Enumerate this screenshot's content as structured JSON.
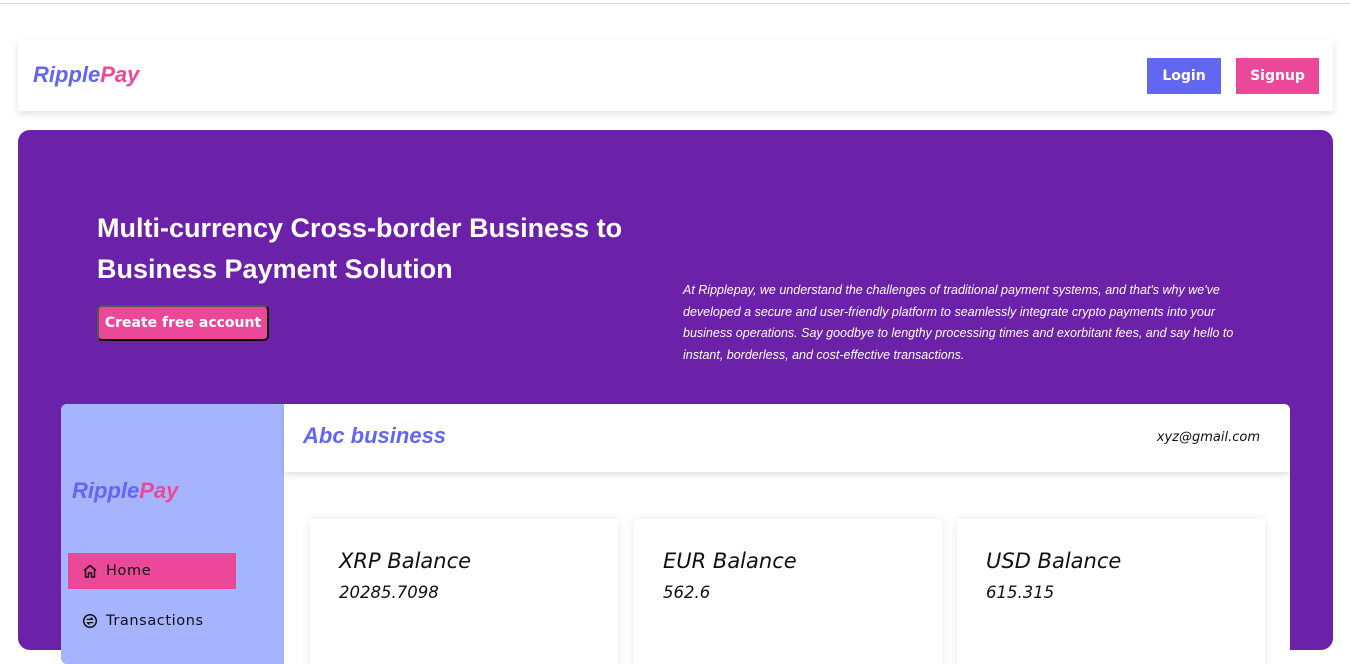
{
  "nav": {
    "brand_part1": "Ripple",
    "brand_part2": "Pay",
    "login_label": "Login",
    "signup_label": "Signup"
  },
  "hero": {
    "title": "Multi-currency Cross-border Business to Business Payment Solution",
    "cta_label": "Create free account",
    "description": "At Ripplepay, we understand the challenges of traditional payment systems, and that's why we've developed a secure and user-friendly platform to seamlessly integrate crypto payments into your business operations. Say goodbye to lengthy processing times and exorbitant fees, and say hello to instant, borderless, and cost-effective transactions."
  },
  "dashboard": {
    "sidebar": {
      "brand_part1": "Ripple",
      "brand_part2": "Pay",
      "items": [
        {
          "label": "Home",
          "icon": "home-icon",
          "active": true
        },
        {
          "label": "Transactions",
          "icon": "transactions-icon",
          "active": false
        }
      ]
    },
    "header": {
      "business_name": "Abc business",
      "email": "xyz@gmail.com"
    },
    "balances": [
      {
        "title": "XRP Balance",
        "value": "20285.7098"
      },
      {
        "title": "EUR Balance",
        "value": "562.6"
      },
      {
        "title": "USD Balance",
        "value": "615.315"
      }
    ]
  },
  "colors": {
    "primary": "#6366f1",
    "accent": "#ec4899",
    "hero_bg": "#6b21a8",
    "sidebar_bg": "#a5b4fc"
  }
}
